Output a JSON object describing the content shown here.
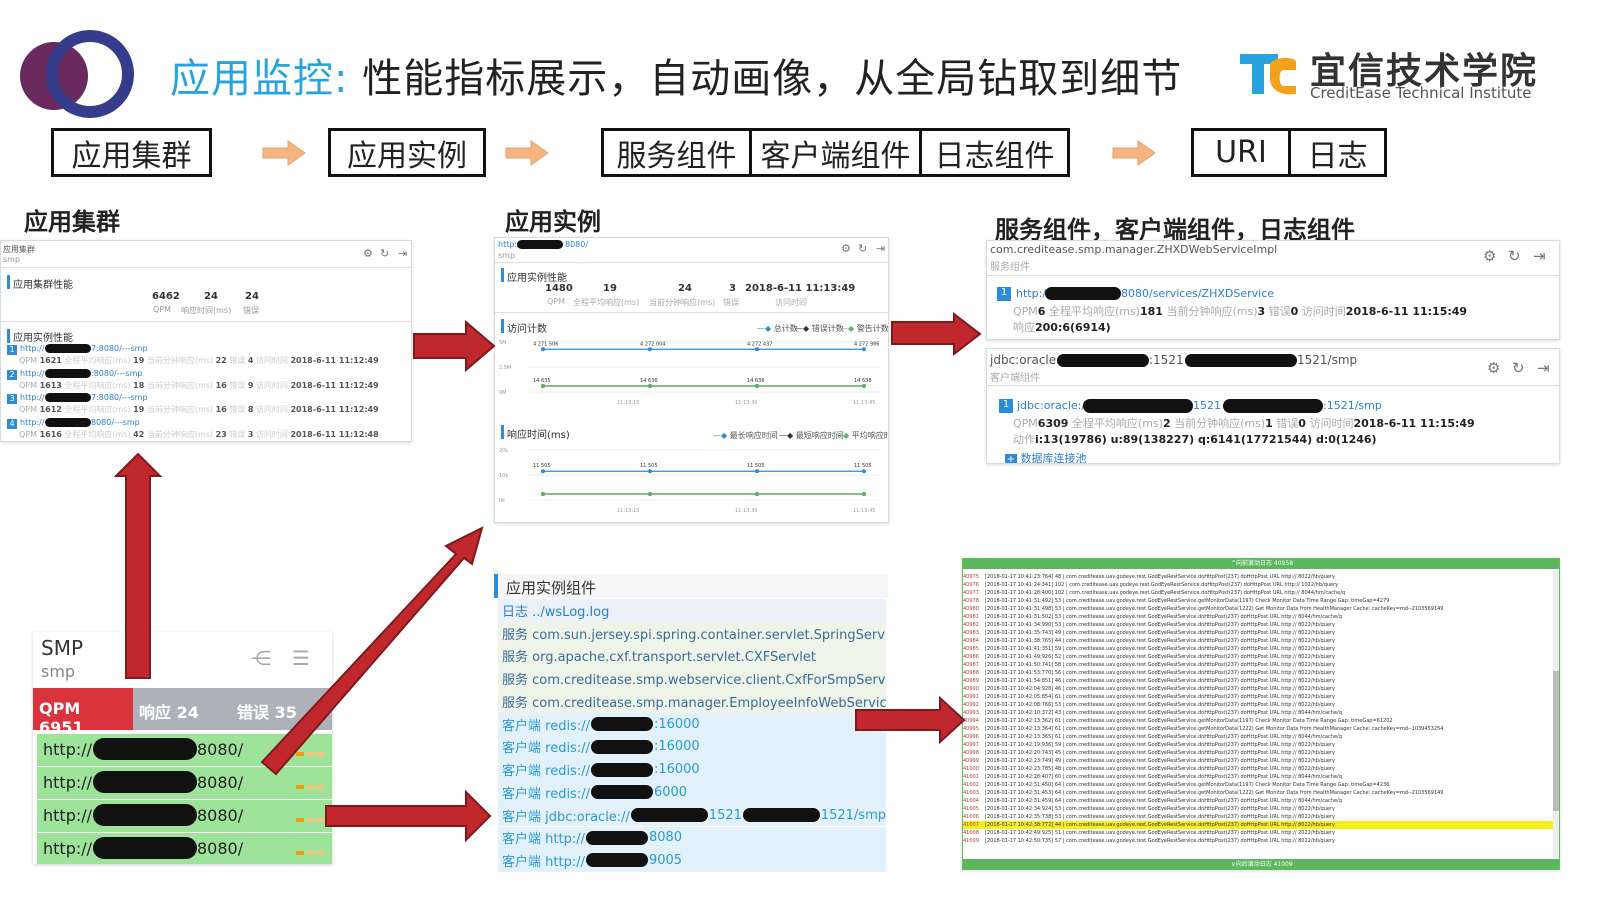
{
  "header": {
    "title_highlight": "应用监控:",
    "title_rest": " 性能指标展示，自动画像，从全局钻取到细节",
    "brand_cn": "宜信技术学院",
    "brand_en": "CreditEase Technical Institute"
  },
  "flow": {
    "cluster": "应用集群",
    "instance": "应用实例",
    "service": "服务组件",
    "client": "客户端组件",
    "log": "日志组件",
    "uri": "URI",
    "rizhi": "日志"
  },
  "sections": {
    "cluster": "应用集群",
    "instance": "应用实例",
    "components": "服务组件，客户端组件，日志组件"
  },
  "cluster_panel": {
    "crumb": "应用集群",
    "crumb2": "smp",
    "perf_title": "应用集群性能",
    "qpm": "6462",
    "resp": "24",
    "err": "24",
    "qpm_label": "QPM",
    "resp_label": "响应时间(ms)",
    "err_label": "错误",
    "inst_title": "应用实例性能",
    "instances": [
      {
        "idx": "1",
        "url_a": "http://",
        "url_b": "7:8080/---smp",
        "qpm": "1621",
        "avg": "19",
        "cur": "22",
        "err": "4",
        "time": "2018-6-11 11:12:49"
      },
      {
        "idx": "2",
        "url_a": "http://",
        "url_b": ":8080/---smp",
        "qpm": "1613",
        "avg": "18",
        "cur": "16",
        "err": "9",
        "time": "2018-6-11 11:12:49"
      },
      {
        "idx": "3",
        "url_a": "http://",
        "url_b": "7:8080/---smp",
        "qpm": "1612",
        "avg": "19",
        "cur": "16",
        "err": "8",
        "time": "2018-6-11 11:12:49"
      },
      {
        "idx": "4",
        "url_a": "http://",
        "url_b": "8080/---smp",
        "qpm": "1616",
        "avg": "42",
        "cur": "23",
        "err": "3",
        "time": "2018-6-11 11:12:48"
      }
    ],
    "lbl_qpm": "QPM",
    "lbl_avg": "全程平均响应(ms)",
    "lbl_cur": "当前分钟响应(ms)",
    "lbl_err": "错误",
    "lbl_time": "访问时间"
  },
  "instance_panel": {
    "url_a": "http://",
    "url_b": "8080/",
    "crumb2": "smp",
    "perf_title": "应用实例性能",
    "qpm": "1480",
    "avg": "19",
    "cur": "24",
    "err": "3",
    "time": "2018-6-11 11:13:49",
    "lbl_qpm": "QPM",
    "lbl_avg": "全程平均响应(ms)",
    "lbl_cur": "当前分钟响应(ms)",
    "lbl_err": "错误",
    "lbl_time": "访问时间",
    "visits_title": "访问计数",
    "visits_legend": [
      "总计数",
      "错误计数",
      "警告计数"
    ],
    "resp_title": "响应时间(ms)",
    "resp_legend": [
      "最长响应时间",
      "最短响应时间",
      "平均响应时间"
    ]
  },
  "chart_data": [
    {
      "type": "line",
      "title": "访问计数",
      "x": [
        "11:13:15",
        "11:13:30",
        "11:13:45"
      ],
      "yticks": [
        "5M",
        "2.5M",
        "0M"
      ],
      "series": [
        {
          "name": "总计数",
          "values": [
            4271506,
            4272004,
            4272437,
            4272986
          ],
          "labels": [
            "4 271 506",
            "4 272 004",
            "4 272 437",
            "4 272 986"
          ]
        },
        {
          "name": "错误计数",
          "values": [
            14635,
            14636,
            14636,
            14638
          ],
          "labels": [
            "14 635",
            "14 636",
            "14 636",
            "14 638"
          ]
        },
        {
          "name": "警告计数",
          "values": [
            0,
            0,
            0,
            0
          ]
        }
      ]
    },
    {
      "type": "line",
      "title": "响应时间(ms)",
      "x": [
        "11:13:15",
        "11:13:30",
        "11:13:45"
      ],
      "yticks": [
        "20k",
        "10k",
        "0k"
      ],
      "series": [
        {
          "name": "最长响应时间",
          "values": [
            11505,
            11505,
            11505,
            11505
          ],
          "labels": [
            "11 505",
            "11 505",
            "11 505",
            "11 505"
          ]
        },
        {
          "name": "最短响应时间",
          "values": [
            0,
            0,
            0,
            0
          ]
        },
        {
          "name": "平均响应时间",
          "values": [
            0,
            0,
            0,
            0
          ]
        }
      ]
    }
  ],
  "service_panel": {
    "class_name": "com.creditease.smp.manager.ZHXDWebServiceImpl",
    "sub": "服务组件",
    "idx": "1",
    "url_a": "http://",
    "url_b": "8080/services/ZHXDService",
    "qpm_label": "QPM",
    "qpm": "6",
    "avg_label": "全程平均响应(ms)",
    "avg": "181",
    "cur_label": "当前分钟响应(ms)",
    "cur": "3",
    "err_label": "错误",
    "err": "0",
    "time_label": "访问时间",
    "time": "2018-6-11 11:15:49",
    "resp_label": "响应",
    "resp": "200:6(6914)"
  },
  "client_panel": {
    "title_a": "jdbc:oracle://",
    "title_b": ":1521",
    "title_c": "1521/smp",
    "sub": "客户端组件",
    "idx": "1",
    "url_a": "jdbc:oracle://",
    "url_b": "1521",
    "url_c": ":1521/smp",
    "qpm_label": "QPM",
    "qpm": "6309",
    "avg_label": "全程平均响应(ms)",
    "avg": "2",
    "cur_label": "当前分钟响应(ms)",
    "cur": "1",
    "err_label": "错误",
    "err": "0",
    "time_label": "访问时间",
    "time": "2018-6-11 11:15:49",
    "action_label": "动作",
    "action": "i:13(19786) u:89(138227) q:6141(17721544) d:0(1246)",
    "pool": "数据库连接池"
  },
  "smp_card": {
    "name": "SMP",
    "sub": "smp",
    "qpm": "QPM 6951",
    "resp": "响应 24",
    "err": "错误 35",
    "rows": [
      {
        "a": "http://",
        "b": "8080/"
      },
      {
        "a": "http://",
        "b": "8080/"
      },
      {
        "a": "http://",
        "b": "8080/"
      },
      {
        "a": "http://",
        "b": "8080/"
      }
    ]
  },
  "components_list": {
    "title": "应用实例组件",
    "log_row": "日志 ../wsLog.log",
    "services": [
      "服务 com.sun.jersey.spi.spring.container.servlet.SpringServlet",
      "服务 org.apache.cxf.transport.servlet.CXFServlet",
      "服务 com.creditease.smp.webservice.client.CxfForSmpServiceImpl",
      "服务 com.creditease.smp.manager.EmployeeInfoWebServiceImp"
    ],
    "clients": [
      {
        "a": "客户端 redis://",
        "b": ":16000"
      },
      {
        "a": "客户端 redis://",
        "b": ":16000"
      },
      {
        "a": "客户端 redis://",
        "b": ":16000"
      },
      {
        "a": "客户端 redis://",
        "b": "6000"
      },
      {
        "a": "客户端 jdbc:oracle://",
        "b": "1521",
        "c": "1521/smp"
      },
      {
        "a": "客户端 http://",
        "b": "8080"
      },
      {
        "a": "客户端 http://",
        "b": "9005"
      }
    ]
  },
  "log_panel": {
    "top_bar": "^向前滚动日志 40958",
    "bottom_bar": "∨向后滚动日志 41009",
    "lines": [
      {
        "n": "40975",
        "t": "[2018-01-17 10:41:23:764] 48 | com.creditease.uav.godeye.rest.GodEyeRestService.doHttpPost(237) doHttpPost URL http://            8022/hb/query"
      },
      {
        "n": "40976",
        "t": "[2018-01-17 10:41:24:341] 102 | com.creditease.uav.godeye.rest.GodEyeRestService.doHttpPost(237) doHttpPost URL http://            1022/hb/query"
      },
      {
        "n": "40977",
        "t": "[2018-01-17 10:41:28:400] 102 | com.creditease.uav.godeye.rest.GodEyeRestService.doHttpPost(237) doHttpPost URL http://          8044/hm/cache/q"
      },
      {
        "n": "40978",
        "t": "[2018-01-17 10:41:31:492] 53 | com.creditease.uav.godeye.rest.GodEyeRestService.getMonitorData(1197) Check Monitor Data Time Range Gap: timeGap=4279"
      },
      {
        "n": "40980",
        "t": "[2018-01-17 10:41:31:498] 53 | com.creditease.uav.godeye.rest.GodEyeRestService.getMonitorData(1222) Get Monitor Data from HealthManager Cache: cacheKey=md--2103569149"
      },
      {
        "n": "40981",
        "t": "[2018-01-17 10:41:31:502] 53 | com.creditease.uav.godeye.rest.GodEyeRestService.doHttpPost(237) doHttpPost URL http://           8044/hm/cache/q"
      },
      {
        "n": "40982",
        "t": "[2018-01-17 10:41:34:990] 53 | com.creditease.uav.godeye.rest.GodEyeRestService.doHttpPost(237) doHttpPost URL http://            8022/hb/query"
      },
      {
        "n": "40983",
        "t": "[2018-01-17 10:41:35:743] 49 | com.creditease.uav.godeye.rest.GodEyeRestService.doHttpPost(237) doHttpPost URL http://            8022/hb/query"
      },
      {
        "n": "40984",
        "t": "[2018-01-17 10:41:38:765] 44 | com.creditease.uav.godeye.rest.GodEyeRestService.doHttpPost(237) doHttpPost URL http://            8022/hb/query"
      },
      {
        "n": "40985",
        "t": "[2018-01-17 10:41:41:351] 59 | com.creditease.uav.godeye.rest.GodEyeRestService.doHttpPost(237) doHttpPost URL http://            8022/hb/query"
      },
      {
        "n": "40986",
        "t": "[2018-01-17 10:41:49:926] 52 | com.creditease.uav.godeye.rest.GodEyeRestService.doHttpPost(237) doHttpPost URL http://            8022/hb/query"
      },
      {
        "n": "40987",
        "t": "[2018-01-17 10:41:50:741] 58 | com.creditease.uav.godeye.rest.GodEyeRestService.doHttpPost(237) doHttpPost URL http://            8022/hb/query"
      },
      {
        "n": "40988",
        "t": "[2018-01-17 10:41:53:770] 56 | com.creditease.uav.godeye.rest.GodEyeRestService.doHttpPost(237) doHttpPost URL http://            8022/hb/query"
      },
      {
        "n": "40989",
        "t": "[2018-01-17 10:41:54:851] 46 | com.creditease.uav.godeye.rest.GodEyeRestService.doHttpPost(237) doHttpPost URL http://            8022/hb/query"
      },
      {
        "n": "40990",
        "t": "[2018-01-17 10:42:04:928] 46 | com.creditease.uav.godeye.rest.GodEyeRestService.doHttpPost(237) doHttpPost URL http://            8022/hb/query"
      },
      {
        "n": "40991",
        "t": "[2018-01-17 10:42:05:854] 61 | com.creditease.uav.godeye.rest.GodEyeRestService.doHttpPost(237) doHttpPost URL http://            8022/hb/query"
      },
      {
        "n": "40992",
        "t": "[2018-01-17 10:42:08:766] 53 | com.creditease.uav.godeye.rest.GodEyeRestService.doHttpPost(237) doHttpPost URL http://            8022/hb/query"
      },
      {
        "n": "40993",
        "t": "[2018-01-17 10:42:10:372] 43 | com.creditease.uav.godeye.rest.GodEyeRestService.doHttpPost(237) doHttpPost URL http://           8044/hm/cache/q"
      },
      {
        "n": "40994",
        "t": "[2018-01-17 10:42:13:362] 61 | com.creditease.uav.godeye.rest.GodEyeRestService.getMonitorData(1197) Check Monitor Data Time Range Gap: timeGap=61202"
      },
      {
        "n": "40995",
        "t": "[2018-01-17 10:42:13:364] 61 | com.creditease.uav.godeye.rest.GodEyeRestService.getMonitorData(1222) Get Monitor Data from HealthManager Cache: cacheKey=md--1039453254"
      },
      {
        "n": "40996",
        "t": "[2018-01-17 10:42:13:365] 61 | com.creditease.uav.godeye.rest.GodEyeRestService.doHttpPost(237) doHttpPost URL http://           8044/hm/cache/q"
      },
      {
        "n": "40997",
        "t": "[2018-01-17 10:42:19:936] 59 | com.creditease.uav.godeye.rest.GodEyeRestService.doHttpPost(237) doHttpPost URL http://            8022/hb/query"
      },
      {
        "n": "40998",
        "t": "[2018-01-17 10:42:20:743] 45 | com.creditease.uav.godeye.rest.GodEyeRestService.doHttpPost(237) doHttpPost URL http://            8022/hb/query"
      },
      {
        "n": "40999",
        "t": "[2018-01-17 10:42:23:749] 49 | com.creditease.uav.godeye.rest.GodEyeRestService.doHttpPost(237) doHttpPost URL http://            8022/hb/query"
      },
      {
        "n": "41000",
        "t": "[2018-01-17 10:42:23:785] 48 | com.creditease.uav.godeye.rest.GodEyeRestService.doHttpPost(237) doHttpPost URL http://            8022/hb/query"
      },
      {
        "n": "41001",
        "t": "[2018-01-17 10:42:28:407] 60 | com.creditease.uav.godeye.rest.GodEyeRestService.doHttpPost(237) doHttpPost URL http://           8044/hm/cache/q"
      },
      {
        "n": "41002",
        "t": "[2018-01-17 10:42:31:450] 64 | com.creditease.uav.godeye.rest.GodEyeRestService.getMonitorData(1197) Check Monitor Data Time Range Gap: timeGap=4236"
      },
      {
        "n": "41003",
        "t": "[2018-01-17 10:42:31:453] 64 | com.creditease.uav.godeye.rest.GodEyeRestService.getMonitorData(1222) Get Monitor Data from HealthManager Cache: cacheKey=md--2103569149"
      },
      {
        "n": "41004",
        "t": "[2018-01-17 10:42:31:459] 64 | com.creditease.uav.godeye.rest.GodEyeRestService.doHttpPost(237) doHttpPost URL http://           8044/hm/cache/q"
      },
      {
        "n": "41005",
        "t": "[2018-01-17 10:42:34:924] 53 | com.creditease.uav.godeye.rest.GodEyeRestService.doHttpPost(237) doHttpPost URL http://            8022/hb/query"
      },
      {
        "n": "41006",
        "t": "[2018-01-17 10:42:35:738] 53 | com.creditease.uav.godeye.rest.GodEyeRestService.doHttpPost(237) doHttpPost URL http://            8022/hb/query"
      },
      {
        "n": "41007",
        "t": "[2018-01-17 10:42:38:772] 44 | com.creditease.uav.godeye.rest.GodEyeRestService.doHttpPost(237) doHttpPost URL http://            8022/hb/query",
        "hl": true
      },
      {
        "n": "41008",
        "t": "[2018-01-17 10:42:49:925] 51 | com.creditease.uav.godeye.rest.GodEyeRestService.doHttpPost(237) doHttpPost URL http://            2022/hb/query"
      },
      {
        "n": "41009",
        "t": "[2018-01-17 10:42:50:735] 57 | com.creditease.uav.godeye.rest.GodEyeRestService.doHttpPost(237) doHttpPost URL http://            8022/hb/query"
      }
    ]
  },
  "colors": {
    "accent": "#27a3dd",
    "arrow_red": "#c0282d",
    "arrow_orange": "#f6b481",
    "green_row": "#9ee39a",
    "red_qpm": "#d9343b"
  }
}
